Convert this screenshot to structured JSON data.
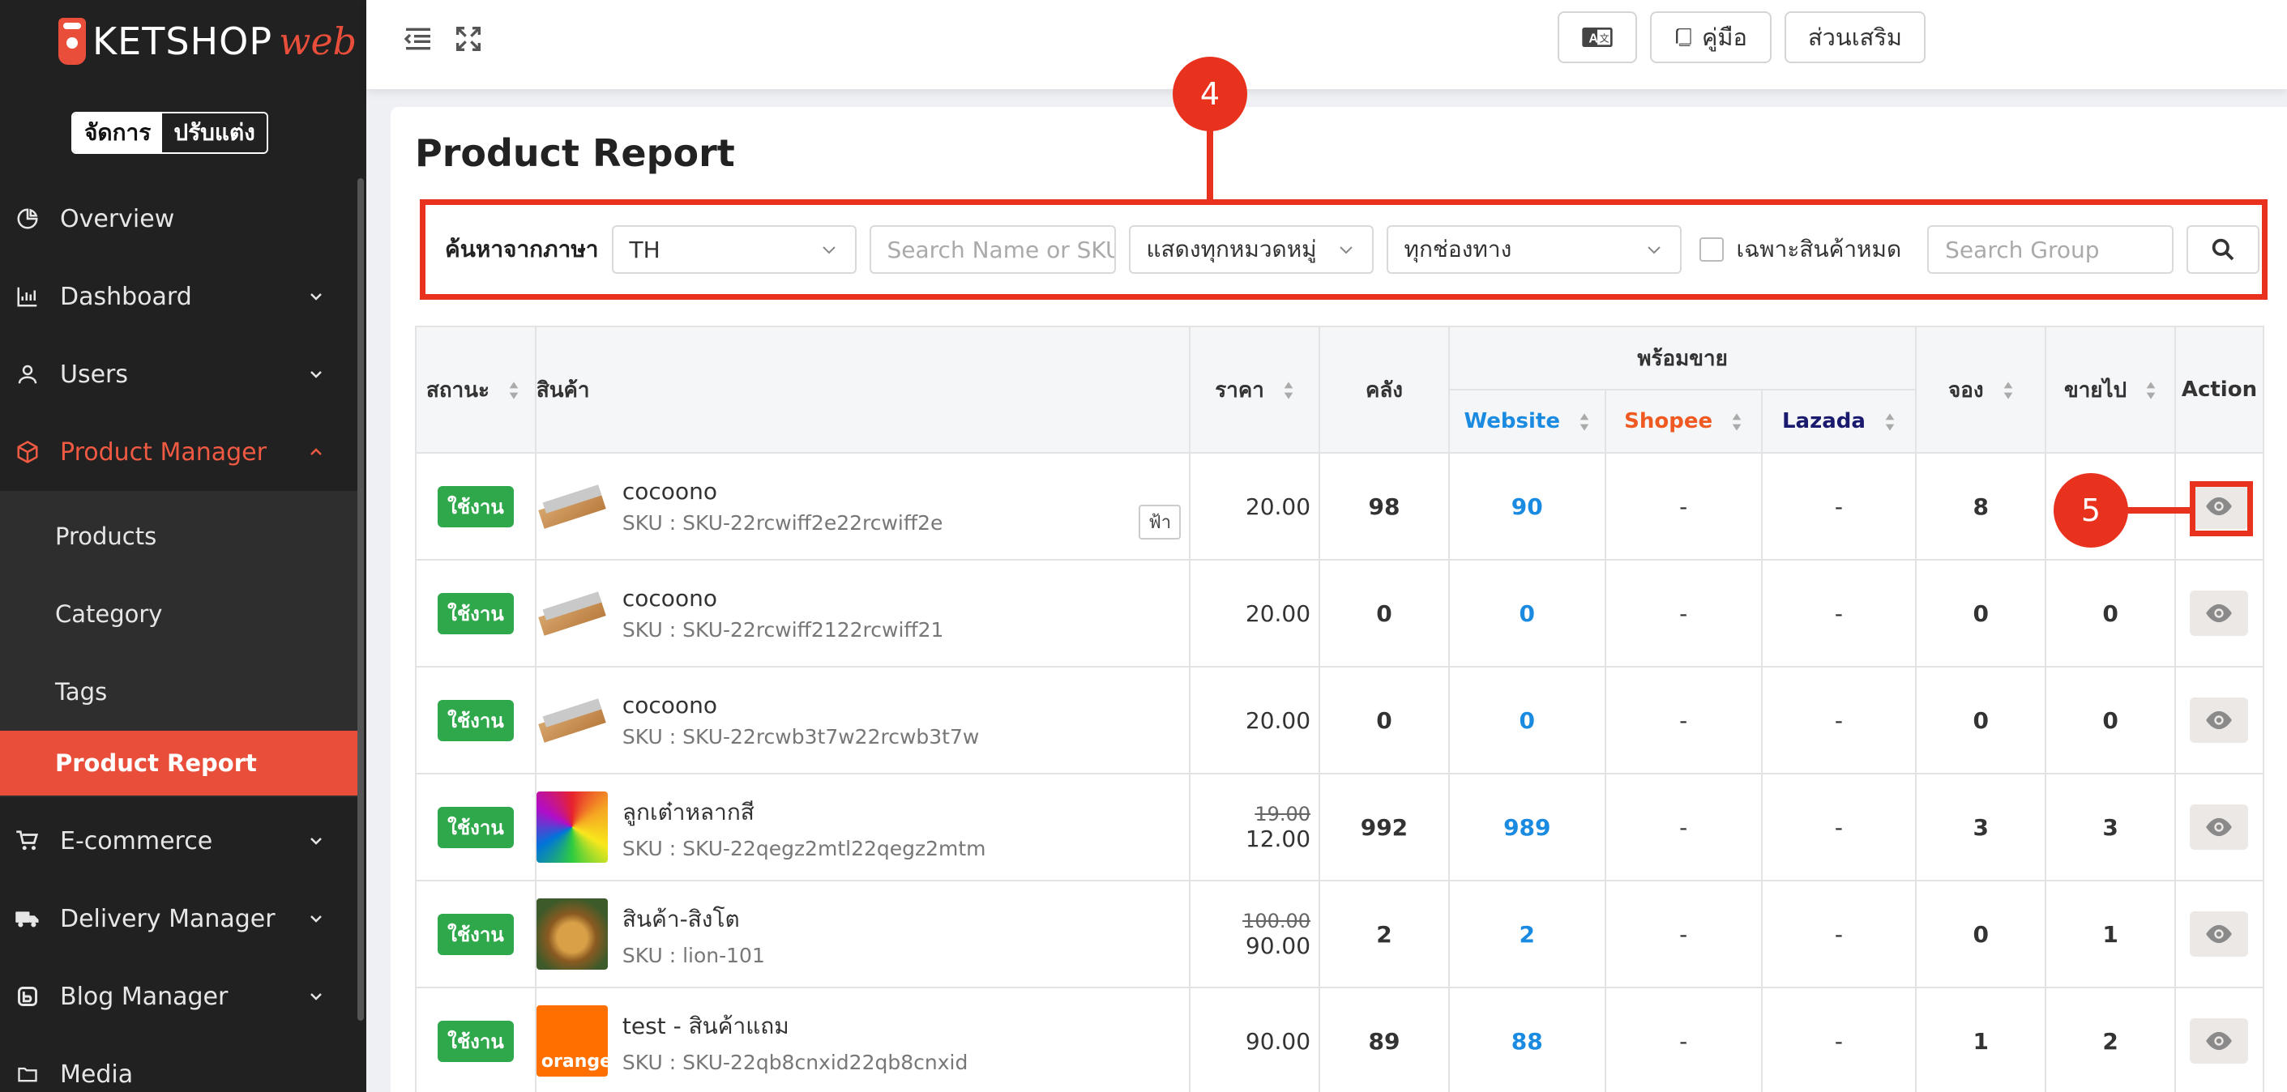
{
  "brand": {
    "name": "KETSHOP",
    "suffix": "web"
  },
  "mode_toggle": {
    "manage": "จัดการ",
    "customize": "ปรับแต่ง"
  },
  "sidebar": {
    "items": [
      {
        "label": "Overview",
        "icon": "pie-chart-icon"
      },
      {
        "label": "Dashboard",
        "icon": "bar-chart-icon"
      },
      {
        "label": "Users",
        "icon": "user-icon"
      },
      {
        "label": "Product Manager",
        "icon": "box-icon"
      },
      {
        "label": "E-commerce",
        "icon": "cart-icon"
      },
      {
        "label": "Delivery Manager",
        "icon": "truck-icon"
      },
      {
        "label": "Blog Manager",
        "icon": "blog-icon"
      },
      {
        "label": "Media",
        "icon": "folder-icon"
      }
    ],
    "sub_items": [
      {
        "label": "Products"
      },
      {
        "label": "Category"
      },
      {
        "label": "Tags"
      },
      {
        "label": "Product Report"
      }
    ]
  },
  "topbar": {
    "manual_label": "คู่มือ",
    "addons_label": "ส่วนเสริม"
  },
  "page": {
    "title": "Product Report"
  },
  "filters": {
    "language_label": "ค้นหาจากภาษา",
    "language_value": "TH",
    "search_placeholder": "Search Name or SKU",
    "category_value": "แสดงทุกหมวดหมู่",
    "channel_value": "ทุกช่องทาง",
    "out_of_stock_label": "เฉพาะสินค้าหมด",
    "group_placeholder": "Search Group"
  },
  "callouts": {
    "filter": "4",
    "action": "5"
  },
  "table": {
    "headers": {
      "status": "สถานะ",
      "product": "สินค้า",
      "price": "ราคา",
      "stock": "คลัง",
      "ready": "พร้อมขาย",
      "website": "Website",
      "shopee": "Shopee",
      "lazada": "Lazada",
      "reserved": "จอง",
      "sold": "ขายไป",
      "action": "Action"
    },
    "status_label": "ใช้งาน",
    "rows": [
      {
        "name": "cocoono",
        "sku": "SKU : SKU-22rcwiff2e22rcwiff2e",
        "tag": "ฟ้า",
        "old_price": "",
        "price": "20.00",
        "stock": "98",
        "website": "90",
        "shopee": "-",
        "lazada": "-",
        "reserved": "8",
        "sold": "",
        "thumb": "wood"
      },
      {
        "name": "cocoono",
        "sku": "SKU : SKU-22rcwiff2122rcwiff21",
        "tag": "",
        "old_price": "",
        "price": "20.00",
        "stock": "0",
        "website": "0",
        "shopee": "-",
        "lazada": "-",
        "reserved": "0",
        "sold": "0",
        "thumb": "wood"
      },
      {
        "name": "cocoono",
        "sku": "SKU : SKU-22rcwb3t7w22rcwb3t7w",
        "tag": "",
        "old_price": "",
        "price": "20.00",
        "stock": "0",
        "website": "0",
        "shopee": "-",
        "lazada": "-",
        "reserved": "0",
        "sold": "0",
        "thumb": "wood"
      },
      {
        "name": "ลูกเต๋าหลากสี",
        "sku": "SKU : SKU-22qegz2mtl22qegz2mtm",
        "tag": "",
        "old_price": "19.00",
        "price": "12.00",
        "stock": "992",
        "website": "989",
        "shopee": "-",
        "lazada": "-",
        "reserved": "3",
        "sold": "3",
        "thumb": "rubik"
      },
      {
        "name": "สินค้า-สิงโต",
        "sku": "SKU : lion-101",
        "tag": "",
        "old_price": "100.00",
        "price": "90.00",
        "stock": "2",
        "website": "2",
        "shopee": "-",
        "lazada": "-",
        "reserved": "0",
        "sold": "1",
        "thumb": "lion"
      },
      {
        "name": "test - สินค้าแถม",
        "sku": "SKU : SKU-22qb8cnxid22qb8cnxid",
        "tag": "",
        "old_price": "",
        "price": "90.00",
        "stock": "89",
        "website": "88",
        "shopee": "-",
        "lazada": "-",
        "reserved": "1",
        "sold": "2",
        "thumb": "orange",
        "thumb_text": "orange"
      }
    ]
  },
  "colors": {
    "accent": "#e84e3a",
    "sidebar_bg": "#212121",
    "website_blue": "#1a8be0",
    "shopee_orange": "#f05a22",
    "lazada_navy": "#1a1a6e",
    "status_green": "#2ea84a",
    "callout_red": "#e8321e"
  }
}
